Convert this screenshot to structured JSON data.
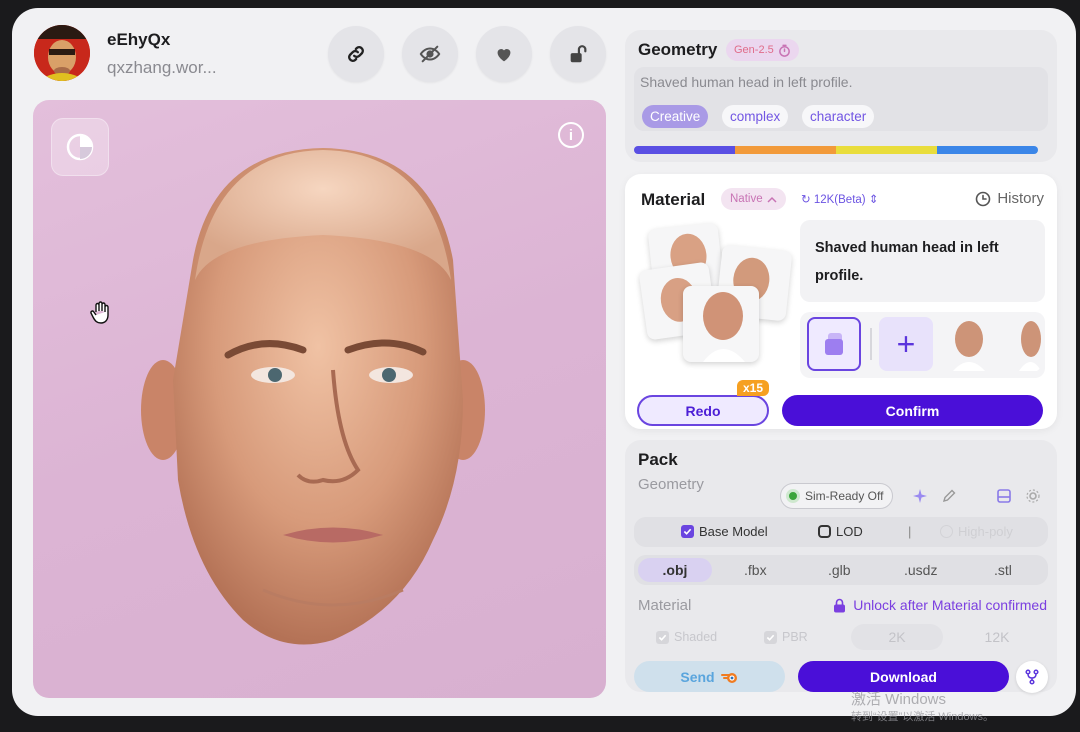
{
  "user": {
    "name": "eEhyQx",
    "handle": "qxzhang.wor..."
  },
  "header_buttons": [
    "link-icon",
    "eye-off-icon",
    "heart-icon",
    "unlock-icon"
  ],
  "viewport": {
    "info_glyph": "i",
    "cursor": "hand-icon",
    "model": "Shaved human head in left profile."
  },
  "geometry": {
    "title": "Geometry",
    "gen_badge": "Gen-2.5",
    "prompt": "Shaved human head in left profile.",
    "tags": [
      "Creative",
      "complex",
      "character"
    ],
    "active_tag": "Creative",
    "stage_colors": [
      "#5a4fe3",
      "#f29a3a",
      "#e9dd3c",
      "#3b86e8"
    ]
  },
  "material": {
    "title": "Material",
    "mode": "Native",
    "resolution": "12K(Beta)",
    "history_label": "History",
    "prompt": "Shaved human head in left profile.",
    "redo_label": "Redo",
    "redo_count": "x15",
    "confirm_label": "Confirm"
  },
  "pack": {
    "title": "Pack",
    "geometry_label": "Geometry",
    "sim_ready_label": "Sim-Ready Off",
    "options": {
      "base_model": {
        "label": "Base Model",
        "checked": true
      },
      "lod": {
        "label": "LOD",
        "checked": false
      },
      "high_poly": {
        "label": "High-poly",
        "enabled": false
      }
    },
    "formats": [
      ".obj",
      ".fbx",
      ".glb",
      ".usdz",
      ".stl"
    ],
    "selected_format": ".obj",
    "material_label": "Material",
    "unlock_message": "Unlock after Material confirmed",
    "material_options": {
      "shaded": {
        "label": "Shaded",
        "checked": true
      },
      "pbr": {
        "label": "PBR",
        "checked": true
      }
    },
    "resolutions": [
      "2K",
      "12K"
    ],
    "send_label": "Send",
    "download_label": "Download"
  },
  "watermark": {
    "line1": "激活 Windows",
    "line2": "转到“设置”以激活 Windows。"
  },
  "colors": {
    "accent": "#4a0fd8",
    "accent_light": "#efeaff",
    "viewport_bg": "#dcb4d4",
    "window_bg": "#f1f1f3"
  }
}
